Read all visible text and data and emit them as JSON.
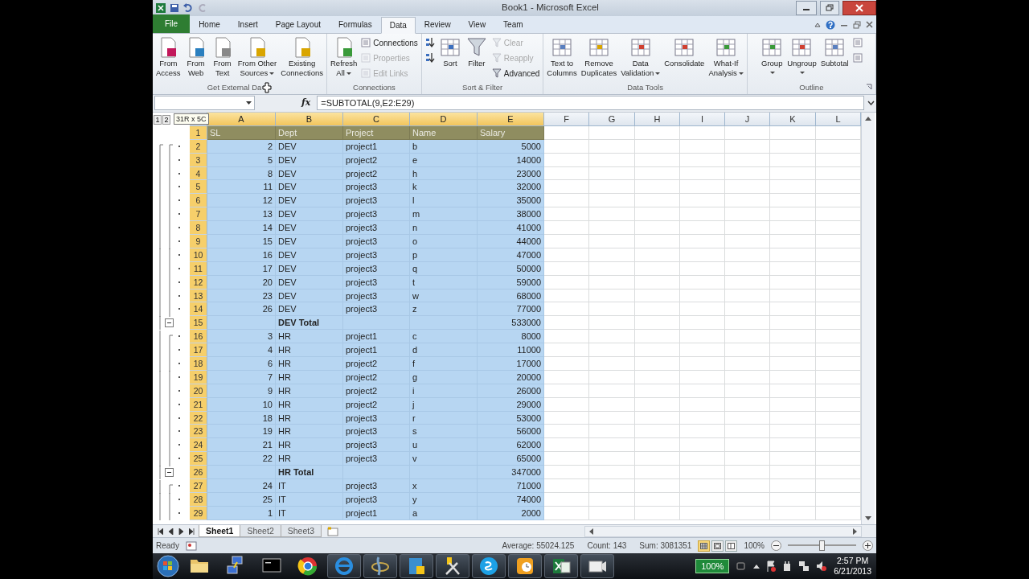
{
  "window": {
    "title": "Book1 - Microsoft Excel"
  },
  "ribbon": {
    "tabs": [
      {
        "label": "File",
        "kind": "file",
        "selected": false
      },
      {
        "label": "Home",
        "kind": "tab",
        "selected": false
      },
      {
        "label": "Insert",
        "kind": "tab",
        "selected": false
      },
      {
        "label": "Page Layout",
        "kind": "tab",
        "selected": false
      },
      {
        "label": "Formulas",
        "kind": "tab",
        "selected": false
      },
      {
        "label": "Data",
        "kind": "tab",
        "selected": true
      },
      {
        "label": "Review",
        "kind": "tab",
        "selected": false
      },
      {
        "label": "View",
        "kind": "tab",
        "selected": false
      },
      {
        "label": "Team",
        "kind": "tab",
        "selected": false
      }
    ],
    "groups": [
      {
        "title": "Get External Da",
        "launcher": false,
        "items": [
          {
            "kind": "large",
            "lines": [
              "From",
              "Access"
            ],
            "dropdown": false
          },
          {
            "kind": "large",
            "lines": [
              "From",
              "Web"
            ],
            "dropdown": false
          },
          {
            "kind": "large",
            "lines": [
              "From",
              "Text"
            ],
            "dropdown": false
          },
          {
            "kind": "large",
            "lines": [
              "From Other",
              "Sources"
            ],
            "dropdown": true
          },
          {
            "kind": "large",
            "lines": [
              "Existing",
              "Connections"
            ],
            "dropdown": false
          }
        ]
      },
      {
        "title": "Connections",
        "launcher": false,
        "items": [
          {
            "kind": "large",
            "lines": [
              "Refresh",
              "All"
            ],
            "dropdown": true
          },
          {
            "kind": "stack",
            "buttons": [
              {
                "label": "Connections",
                "disabled": false
              },
              {
                "label": "Properties",
                "disabled": true
              },
              {
                "label": "Edit Links",
                "disabled": true
              }
            ]
          }
        ]
      },
      {
        "title": "Sort & Filter",
        "launcher": false,
        "items": [
          {
            "kind": "stack",
            "buttons": [
              {
                "disabled": false
              },
              {
                "disabled": false
              }
            ]
          },
          {
            "kind": "large",
            "lines": [
              "Sort"
            ],
            "dropdown": false
          },
          {
            "kind": "large",
            "lines": [
              "Filter"
            ],
            "dropdown": false
          },
          {
            "kind": "stack",
            "buttons": [
              {
                "label": "Clear",
                "disabled": true
              },
              {
                "label": "Reapply",
                "disabled": true
              },
              {
                "label": "Advanced",
                "disabled": false
              }
            ]
          }
        ]
      },
      {
        "title": "Data Tools",
        "launcher": false,
        "items": [
          {
            "kind": "large",
            "lines": [
              "Text to",
              "Columns"
            ],
            "dropdown": false
          },
          {
            "kind": "large",
            "lines": [
              "Remove",
              "Duplicates"
            ],
            "dropdown": false
          },
          {
            "kind": "large",
            "lines": [
              "Data",
              "Validation"
            ],
            "dropdown": true
          },
          {
            "kind": "large",
            "lines": [
              "Consolidate"
            ],
            "dropdown": false
          },
          {
            "kind": "large",
            "lines": [
              "What-If",
              "Analysis"
            ],
            "dropdown": true
          }
        ]
      },
      {
        "title": "Outline",
        "launcher": true,
        "items": [
          {
            "kind": "large",
            "lines": [
              "Group"
            ],
            "dropdown": true
          },
          {
            "kind": "large",
            "lines": [
              "Ungroup"
            ],
            "dropdown": true
          },
          {
            "kind": "large",
            "lines": [
              "Subtotal"
            ],
            "dropdown": false
          },
          {
            "kind": "stack",
            "buttons": [
              {
                "disabled": false
              },
              {
                "disabled": false
              }
            ]
          }
        ]
      }
    ]
  },
  "formula_bar": {
    "function_label": "fx",
    "formula": "=SUBTOTAL(9,E2:E29)"
  },
  "sheet": {
    "outline_levels": [
      "1",
      "2"
    ],
    "selection_tip": "31R x 5C",
    "columns": [
      {
        "label": "A",
        "selected": true
      },
      {
        "label": "B",
        "selected": true
      },
      {
        "label": "C",
        "selected": true
      },
      {
        "label": "D",
        "selected": true
      },
      {
        "label": "E",
        "selected": true
      },
      {
        "label": "F",
        "selected": false
      },
      {
        "label": "G",
        "selected": false
      },
      {
        "label": "H",
        "selected": false
      },
      {
        "label": "I",
        "selected": false
      },
      {
        "label": "J",
        "selected": false
      },
      {
        "label": "K",
        "selected": false
      },
      {
        "label": "L",
        "selected": false
      }
    ],
    "rows": [
      {
        "number": "1",
        "kind": "header",
        "selected": true,
        "cells": {
          "sl": "SL",
          "dept": "Dept",
          "project": "Project",
          "name": "Name",
          "salary": "Salary"
        }
      },
      {
        "number": "2",
        "kind": "data",
        "selected": true,
        "cells": {
          "sl": "2",
          "dept": "DEV",
          "project": "project1",
          "name": "b",
          "salary": "5000"
        }
      },
      {
        "number": "3",
        "kind": "data",
        "selected": true,
        "cells": {
          "sl": "5",
          "dept": "DEV",
          "project": "project2",
          "name": "e",
          "salary": "14000"
        }
      },
      {
        "number": "4",
        "kind": "data",
        "selected": true,
        "cells": {
          "sl": "8",
          "dept": "DEV",
          "project": "project2",
          "name": "h",
          "salary": "23000"
        }
      },
      {
        "number": "5",
        "kind": "data",
        "selected": true,
        "cells": {
          "sl": "11",
          "dept": "DEV",
          "project": "project3",
          "name": "k",
          "salary": "32000"
        }
      },
      {
        "number": "6",
        "kind": "data",
        "selected": true,
        "cells": {
          "sl": "12",
          "dept": "DEV",
          "project": "project3",
          "name": "l",
          "salary": "35000"
        }
      },
      {
        "number": "7",
        "kind": "data",
        "selected": true,
        "cells": {
          "sl": "13",
          "dept": "DEV",
          "project": "project3",
          "name": "m",
          "salary": "38000"
        }
      },
      {
        "number": "8",
        "kind": "data",
        "selected": true,
        "cells": {
          "sl": "14",
          "dept": "DEV",
          "project": "project3",
          "name": "n",
          "salary": "41000"
        }
      },
      {
        "number": "9",
        "kind": "data",
        "selected": true,
        "cells": {
          "sl": "15",
          "dept": "DEV",
          "project": "project3",
          "name": "o",
          "salary": "44000"
        }
      },
      {
        "number": "10",
        "kind": "data",
        "selected": true,
        "cells": {
          "sl": "16",
          "dept": "DEV",
          "project": "project3",
          "name": "p",
          "salary": "47000"
        }
      },
      {
        "number": "11",
        "kind": "data",
        "selected": true,
        "cells": {
          "sl": "17",
          "dept": "DEV",
          "project": "project3",
          "name": "q",
          "salary": "50000"
        }
      },
      {
        "number": "12",
        "kind": "data",
        "selected": true,
        "cells": {
          "sl": "20",
          "dept": "DEV",
          "project": "project3",
          "name": "t",
          "salary": "59000"
        }
      },
      {
        "number": "13",
        "kind": "data",
        "selected": true,
        "cells": {
          "sl": "23",
          "dept": "DEV",
          "project": "project3",
          "name": "w",
          "salary": "68000"
        }
      },
      {
        "number": "14",
        "kind": "data",
        "selected": true,
        "cells": {
          "sl": "26",
          "dept": "DEV",
          "project": "project3",
          "name": "z",
          "salary": "77000"
        }
      },
      {
        "number": "15",
        "kind": "total",
        "selected": true,
        "cells": {
          "dept": "DEV Total",
          "salary": "533000"
        }
      },
      {
        "number": "16",
        "kind": "data",
        "selected": true,
        "cells": {
          "sl": "3",
          "dept": "HR",
          "project": "project1",
          "name": "c",
          "salary": "8000"
        }
      },
      {
        "number": "17",
        "kind": "data",
        "selected": true,
        "cells": {
          "sl": "4",
          "dept": "HR",
          "project": "project1",
          "name": "d",
          "salary": "11000"
        }
      },
      {
        "number": "18",
        "kind": "data",
        "selected": true,
        "cells": {
          "sl": "6",
          "dept": "HR",
          "project": "project2",
          "name": "f",
          "salary": "17000"
        }
      },
      {
        "number": "19",
        "kind": "data",
        "selected": true,
        "cells": {
          "sl": "7",
          "dept": "HR",
          "project": "project2",
          "name": "g",
          "salary": "20000"
        }
      },
      {
        "number": "20",
        "kind": "data",
        "selected": true,
        "cells": {
          "sl": "9",
          "dept": "HR",
          "project": "project2",
          "name": "i",
          "salary": "26000"
        }
      },
      {
        "number": "21",
        "kind": "data",
        "selected": true,
        "cells": {
          "sl": "10",
          "dept": "HR",
          "project": "project2",
          "name": "j",
          "salary": "29000"
        }
      },
      {
        "number": "22",
        "kind": "data",
        "selected": true,
        "cells": {
          "sl": "18",
          "dept": "HR",
          "project": "project3",
          "name": "r",
          "salary": "53000"
        }
      },
      {
        "number": "23",
        "kind": "data",
        "selected": true,
        "cells": {
          "sl": "19",
          "dept": "HR",
          "project": "project3",
          "name": "s",
          "salary": "56000"
        }
      },
      {
        "number": "24",
        "kind": "data",
        "selected": true,
        "cells": {
          "sl": "21",
          "dept": "HR",
          "project": "project3",
          "name": "u",
          "salary": "62000"
        }
      },
      {
        "number": "25",
        "kind": "data",
        "selected": true,
        "cells": {
          "sl": "22",
          "dept": "HR",
          "project": "project3",
          "name": "v",
          "salary": "65000"
        }
      },
      {
        "number": "26",
        "kind": "total",
        "selected": true,
        "cells": {
          "dept": "HR Total",
          "salary": "347000"
        }
      },
      {
        "number": "27",
        "kind": "data",
        "selected": true,
        "cells": {
          "sl": "24",
          "dept": "IT",
          "project": "project3",
          "name": "x",
          "salary": "71000"
        }
      },
      {
        "number": "28",
        "kind": "data",
        "selected": true,
        "cells": {
          "sl": "25",
          "dept": "IT",
          "project": "project3",
          "name": "y",
          "salary": "74000"
        }
      },
      {
        "number": "29",
        "kind": "data",
        "selected": true,
        "cells": {
          "sl": "1",
          "dept": "IT",
          "project": "project1",
          "name": "a",
          "salary": "2000"
        }
      }
    ],
    "tabs": [
      {
        "label": "Sheet1",
        "selected": true
      },
      {
        "label": "Sheet2",
        "selected": false
      },
      {
        "label": "Sheet3",
        "selected": false
      }
    ]
  },
  "status_bar": {
    "mode": "Ready",
    "stats": [
      "Average: 55024.125",
      "Count: 143",
      "Sum: 3081351"
    ],
    "views": [
      {
        "selected": true
      },
      {
        "selected": false
      },
      {
        "selected": false
      }
    ],
    "zoom": "100%",
    "zoom_level": {
      "level": 0.5
    }
  },
  "taskbar": {
    "apps": [
      {
        "running": false
      },
      {
        "running": false
      },
      {
        "running": false
      },
      {
        "running": false
      },
      {
        "running": true
      },
      {
        "running": true
      },
      {
        "running": true
      },
      {
        "running": true
      },
      {
        "running": true
      },
      {
        "running": true
      },
      {
        "running": true
      },
      {
        "running": true
      }
    ],
    "battery": "100%",
    "time": "2:57 PM",
    "date": "6/21/2013"
  }
}
